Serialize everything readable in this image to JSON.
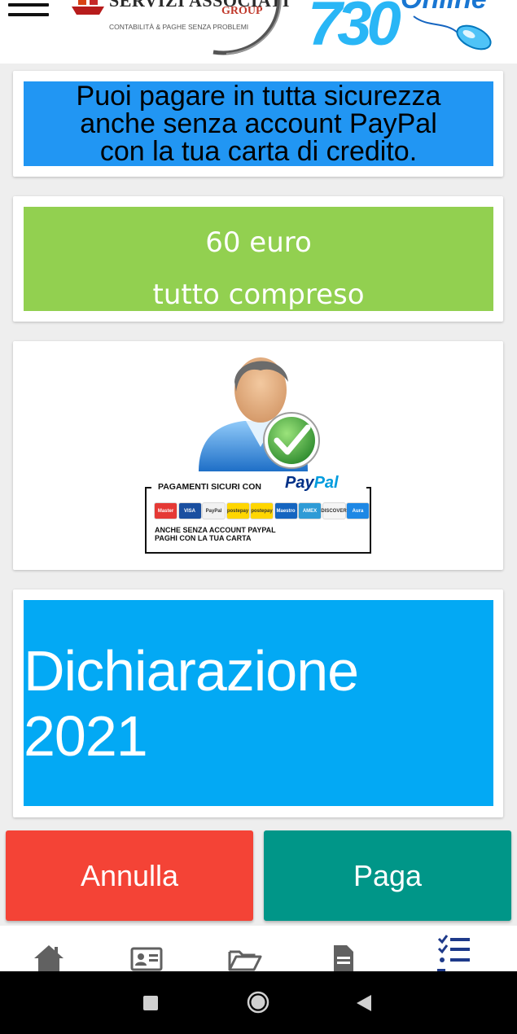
{
  "header": {
    "logo_servizi": {
      "name": "SERVIZI ASSOCIATI",
      "group": "GROUP",
      "slogan": "CONTABILITÀ & PAGHE SENZA PROBLEMI"
    },
    "logo_730": "730",
    "logo_online": "Online"
  },
  "secure_banner": {
    "lines": [
      "Puoi pagare in tutta sicurezza",
      "anche senza account PayPal",
      "con la tua carta di credito."
    ]
  },
  "price_banner": {
    "line1": "60 euro",
    "line2": "tutto compreso"
  },
  "paypal_badge": {
    "title": "PAGAMENTI SICURI CON",
    "logo_pay": "Pay",
    "logo_pal": "Pal",
    "cards": [
      {
        "label": "Master",
        "color": "#e53935"
      },
      {
        "label": "VISA",
        "color": "#1a4fa0"
      },
      {
        "label": "PayPal",
        "color": "#f2f2f2"
      },
      {
        "label": "postepay",
        "color": "#ffd600"
      },
      {
        "label": "postepay",
        "color": "#ffd600"
      },
      {
        "label": "Maestro",
        "color": "#1565c0"
      },
      {
        "label": "AMEX",
        "color": "#2e9bd6"
      },
      {
        "label": "DISCOVER",
        "color": "#f5f5f5"
      },
      {
        "label": "Aura",
        "color": "#1e88e5"
      }
    ],
    "note_line1": "ANCHE SENZA ACCOUNT PAYPAL",
    "note_line2": "PAGHI CON LA TUA CARTA"
  },
  "year_banner": {
    "text": "Dichiarazione 2021"
  },
  "actions": {
    "cancel_label": "Annulla",
    "pay_label": "Paga"
  },
  "colors": {
    "cancel": "#f44336",
    "pay": "#009688",
    "secure_bg": "#2196f3",
    "price_bg": "#92d050",
    "year_bg": "#03a9f4"
  },
  "bottom_nav": {
    "items": [
      "home-icon",
      "contact-card-icon",
      "folder-open-icon",
      "document-icon",
      "checklist-icon"
    ]
  }
}
